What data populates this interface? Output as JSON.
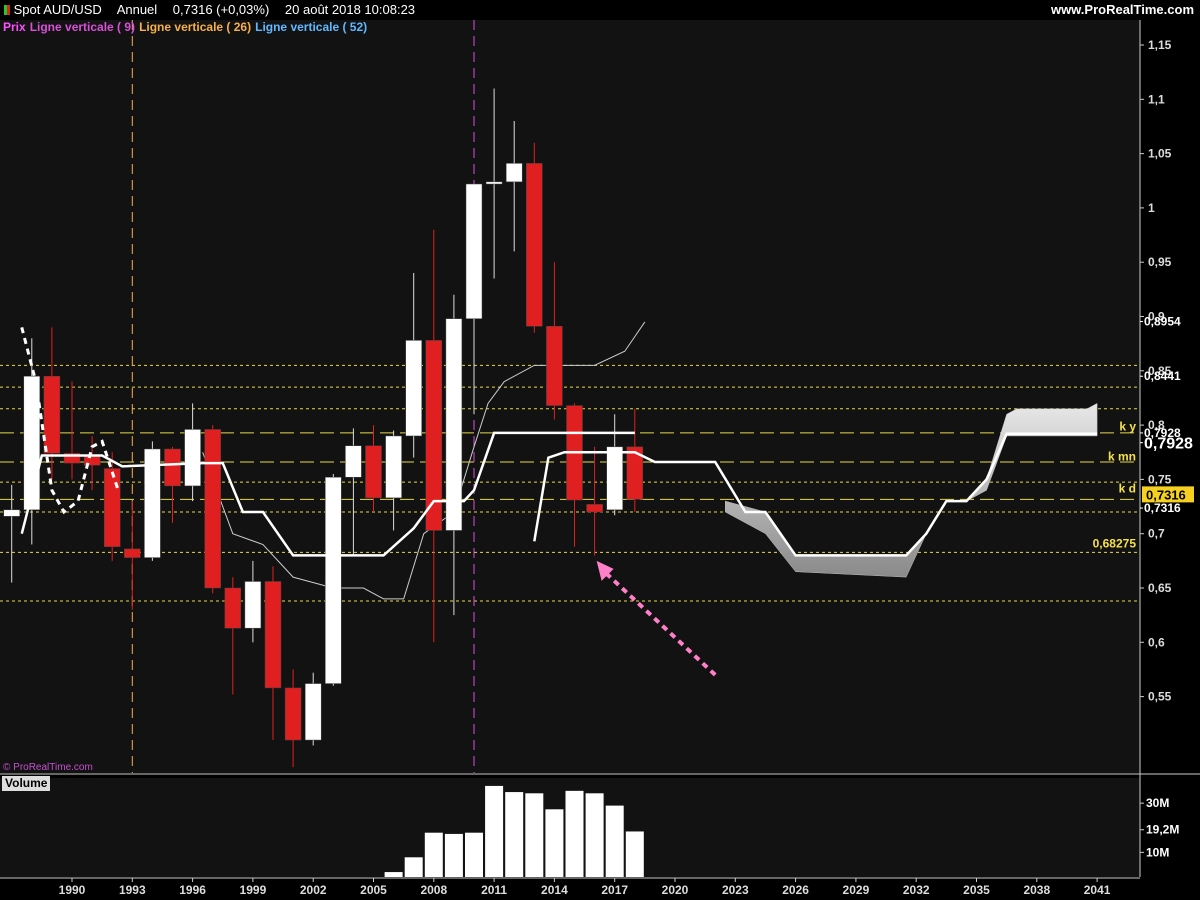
{
  "header": {
    "instrument": "Spot AUD/USD",
    "period": "Annuel",
    "price_change": "0,7316 (+0,03%)",
    "datetime": "20 août 2018 10:08:23",
    "site": "www.ProRealTime.com"
  },
  "legend": [
    {
      "label": "Prix",
      "color": "#ff4fff"
    },
    {
      "label": "Ligne verticale ( 9)",
      "color": "#d94fd9"
    },
    {
      "label": "Ligne verticale ( 26)",
      "color": "#f5b04a"
    },
    {
      "label": "Ligne verticale ( 52)",
      "color": "#60b8ff"
    }
  ],
  "watermark": "© ProRealTime.com",
  "volume_label": "Volume",
  "right_labels": {
    "ky": "k y",
    "kmn": "k mn",
    "kd": "k d",
    "fib": "0,68275",
    "v8954": "0,8954",
    "v8441": "0,8441",
    "v7928a": "0,7928",
    "v7928b": "0,7928",
    "v7316a": "0,7316",
    "v7316b": "0,7316"
  },
  "chart_data": {
    "type": "candlestick",
    "price_axis": {
      "min": 0.49,
      "max": 1.17,
      "ticks": [
        "1,15",
        "1,1",
        "1,05",
        "1",
        "0,95",
        "0,9",
        "0,85",
        "0,8",
        "0,75",
        "0,7",
        "0,65",
        "0,6",
        "0,55"
      ],
      "tick_values": [
        1.15,
        1.1,
        1.05,
        1,
        0.95,
        0.9,
        0.85,
        0.8,
        0.75,
        0.7,
        0.65,
        0.6,
        0.55
      ]
    },
    "x_axis": {
      "ticks": [
        "1990",
        "1993",
        "1996",
        "1999",
        "2002",
        "2005",
        "2008",
        "2011",
        "2014",
        "2017",
        "2020",
        "2023",
        "2026",
        "2029",
        "2032",
        "2035",
        "2038",
        "2041"
      ],
      "tick_years": [
        1990,
        1993,
        1996,
        1999,
        2002,
        2005,
        2008,
        2011,
        2014,
        2017,
        2020,
        2023,
        2026,
        2029,
        2032,
        2035,
        2038,
        2041
      ]
    },
    "candles": [
      {
        "year": 1987,
        "o": 0.716,
        "h": 0.745,
        "l": 0.655,
        "c": 0.722
      },
      {
        "year": 1988,
        "o": 0.722,
        "h": 0.88,
        "l": 0.69,
        "c": 0.845
      },
      {
        "year": 1989,
        "o": 0.845,
        "h": 0.89,
        "l": 0.75,
        "c": 0.774
      },
      {
        "year": 1990,
        "o": 0.774,
        "h": 0.84,
        "l": 0.75,
        "c": 0.765
      },
      {
        "year": 1991,
        "o": 0.771,
        "h": 0.79,
        "l": 0.74,
        "c": 0.763
      },
      {
        "year": 1992,
        "o": 0.76,
        "h": 0.775,
        "l": 0.675,
        "c": 0.688
      },
      {
        "year": 1993,
        "o": 0.686,
        "h": 0.73,
        "l": 0.63,
        "c": 0.678
      },
      {
        "year": 1994,
        "o": 0.678,
        "h": 0.785,
        "l": 0.675,
        "c": 0.778
      },
      {
        "year": 1995,
        "o": 0.778,
        "h": 0.78,
        "l": 0.71,
        "c": 0.744
      },
      {
        "year": 1996,
        "o": 0.744,
        "h": 0.82,
        "l": 0.73,
        "c": 0.796
      },
      {
        "year": 1997,
        "o": 0.796,
        "h": 0.8,
        "l": 0.645,
        "c": 0.65
      },
      {
        "year": 1998,
        "o": 0.65,
        "h": 0.66,
        "l": 0.552,
        "c": 0.613
      },
      {
        "year": 1999,
        "o": 0.613,
        "h": 0.675,
        "l": 0.6,
        "c": 0.656
      },
      {
        "year": 2000,
        "o": 0.656,
        "h": 0.67,
        "l": 0.51,
        "c": 0.558
      },
      {
        "year": 2001,
        "o": 0.558,
        "h": 0.575,
        "l": 0.485,
        "c": 0.51
      },
      {
        "year": 2002,
        "o": 0.51,
        "h": 0.572,
        "l": 0.505,
        "c": 0.562
      },
      {
        "year": 2003,
        "o": 0.562,
        "h": 0.755,
        "l": 0.56,
        "c": 0.752
      },
      {
        "year": 2004,
        "o": 0.752,
        "h": 0.797,
        "l": 0.68,
        "c": 0.781
      },
      {
        "year": 2005,
        "o": 0.781,
        "h": 0.8,
        "l": 0.72,
        "c": 0.733
      },
      {
        "year": 2006,
        "o": 0.733,
        "h": 0.795,
        "l": 0.703,
        "c": 0.79
      },
      {
        "year": 2007,
        "o": 0.79,
        "h": 0.94,
        "l": 0.77,
        "c": 0.878
      },
      {
        "year": 2008,
        "o": 0.878,
        "h": 0.98,
        "l": 0.6,
        "c": 0.703
      },
      {
        "year": 2009,
        "o": 0.703,
        "h": 0.92,
        "l": 0.625,
        "c": 0.898
      },
      {
        "year": 2010,
        "o": 0.898,
        "h": 1.02,
        "l": 0.81,
        "c": 1.022
      },
      {
        "year": 2011,
        "o": 1.022,
        "h": 1.11,
        "l": 0.935,
        "c": 1.024
      },
      {
        "year": 2012,
        "o": 1.024,
        "h": 1.08,
        "l": 0.96,
        "c": 1.041
      },
      {
        "year": 2013,
        "o": 1.041,
        "h": 1.06,
        "l": 0.885,
        "c": 0.891
      },
      {
        "year": 2014,
        "o": 0.891,
        "h": 0.95,
        "l": 0.805,
        "c": 0.818
      },
      {
        "year": 2015,
        "o": 0.818,
        "h": 0.82,
        "l": 0.688,
        "c": 0.731
      },
      {
        "year": 2016,
        "o": 0.727,
        "h": 0.78,
        "l": 0.68,
        "c": 0.72
      },
      {
        "year": 2017,
        "o": 0.722,
        "h": 0.81,
        "l": 0.717,
        "c": 0.78
      },
      {
        "year": 2018,
        "o": 0.78,
        "h": 0.815,
        "l": 0.72,
        "c": 0.7316
      }
    ],
    "horizontal_levels": [
      {
        "value": 0.855,
        "style": "dotted"
      },
      {
        "value": 0.835,
        "style": "dotted"
      },
      {
        "value": 0.815,
        "style": "dotted"
      },
      {
        "value": 0.7928,
        "style": "dashed"
      },
      {
        "value": 0.766,
        "style": "dashed"
      },
      {
        "value": 0.7475,
        "style": "dotted"
      },
      {
        "value": 0.7316,
        "style": "dashed"
      },
      {
        "value": 0.72,
        "style": "dotted"
      },
      {
        "value": 0.68275,
        "style": "dotted"
      },
      {
        "value": 0.638,
        "style": "dotted"
      }
    ],
    "vertical_lines": [
      {
        "year": 1993,
        "color": "#f5b04a"
      },
      {
        "year": 2010,
        "color": "#d94fd9"
      }
    ],
    "kijun_line": [
      [
        1987.5,
        0.7
      ],
      [
        1988.5,
        0.772
      ],
      [
        1991.5,
        0.772
      ],
      [
        1992.5,
        0.762
      ],
      [
        1996.5,
        0.765
      ],
      [
        1997.5,
        0.765
      ],
      [
        1998.5,
        0.72
      ],
      [
        1999.5,
        0.72
      ],
      [
        2001,
        0.68
      ],
      [
        2005.5,
        0.68
      ],
      [
        2007,
        0.705
      ],
      [
        2008,
        0.73
      ],
      [
        2009.5,
        0.73
      ],
      [
        2010,
        0.74
      ],
      [
        2011,
        0.7928
      ],
      [
        2018,
        0.7928
      ]
    ],
    "kijun_segment2": [
      [
        2013,
        0.693
      ],
      [
        2013.7,
        0.77
      ],
      [
        2014.5,
        0.775
      ],
      [
        2018,
        0.775
      ],
      [
        2019,
        0.766
      ],
      [
        2022,
        0.766
      ],
      [
        2023.5,
        0.72
      ],
      [
        2024.5,
        0.72
      ],
      [
        2026,
        0.68
      ],
      [
        2031.5,
        0.68
      ],
      [
        2032.5,
        0.7
      ],
      [
        2033.5,
        0.73
      ],
      [
        2034.5,
        0.73
      ],
      [
        2035.5,
        0.75
      ],
      [
        2036.5,
        0.792
      ],
      [
        2041,
        0.792
      ]
    ],
    "thin_line": [
      [
        1996.5,
        0.775
      ],
      [
        1998,
        0.7
      ],
      [
        1999.5,
        0.69
      ],
      [
        2001,
        0.66
      ],
      [
        2003,
        0.65
      ],
      [
        2004.5,
        0.65
      ],
      [
        2005.5,
        0.64
      ],
      [
        2006.5,
        0.64
      ],
      [
        2007.5,
        0.7
      ],
      [
        2009,
        0.72
      ],
      [
        2010,
        0.78
      ],
      [
        2010.7,
        0.82
      ],
      [
        2011.5,
        0.84
      ],
      [
        2013,
        0.855
      ],
      [
        2016,
        0.855
      ],
      [
        2017.5,
        0.868
      ],
      [
        2018.5,
        0.895
      ]
    ],
    "cloud": {
      "upper": [
        [
          2022.5,
          0.73
        ],
        [
          2024.5,
          0.72
        ],
        [
          2026,
          0.68
        ],
        [
          2031.5,
          0.68
        ],
        [
          2032.5,
          0.7
        ],
        [
          2033.5,
          0.73
        ],
        [
          2034.5,
          0.73
        ],
        [
          2035.5,
          0.75
        ],
        [
          2036.5,
          0.81
        ],
        [
          2037,
          0.815
        ],
        [
          2040.5,
          0.815
        ],
        [
          2041,
          0.82
        ]
      ],
      "lower": [
        [
          2022.5,
          0.72
        ],
        [
          2024.5,
          0.7
        ],
        [
          2026,
          0.665
        ],
        [
          2031.5,
          0.66
        ],
        [
          2032.5,
          0.7
        ],
        [
          2033.5,
          0.73
        ],
        [
          2034.5,
          0.73
        ],
        [
          2035.5,
          0.74
        ],
        [
          2036.5,
          0.79
        ],
        [
          2041,
          0.79
        ]
      ]
    },
    "dashed_white": [
      [
        1987.5,
        0.89
      ],
      [
        1988.2,
        0.84
      ],
      [
        1989,
        0.74
      ],
      [
        1989.6,
        0.72
      ],
      [
        1990.3,
        0.73
      ],
      [
        1991,
        0.78
      ],
      [
        1991.5,
        0.785
      ],
      [
        1992.3,
        0.74
      ]
    ],
    "pink_arrow": {
      "from": [
        2022,
        0.57
      ],
      "to": [
        2016.1,
        0.675
      ]
    },
    "volume": {
      "labels": [
        "30M",
        "19,2M",
        "10M"
      ],
      "label_values": [
        30,
        19.2,
        10
      ],
      "max": 39,
      "bars": [
        {
          "year": 2006,
          "value": 2
        },
        {
          "year": 2007,
          "value": 8
        },
        {
          "year": 2008,
          "value": 18
        },
        {
          "year": 2009,
          "value": 17.5
        },
        {
          "year": 2010,
          "value": 18
        },
        {
          "year": 2011,
          "value": 37
        },
        {
          "year": 2012,
          "value": 34.5
        },
        {
          "year": 2013,
          "value": 34
        },
        {
          "year": 2014,
          "value": 27.5
        },
        {
          "year": 2015,
          "value": 35
        },
        {
          "year": 2016,
          "value": 34
        },
        {
          "year": 2017,
          "value": 29
        },
        {
          "year": 2018,
          "value": 18.5
        }
      ]
    }
  }
}
